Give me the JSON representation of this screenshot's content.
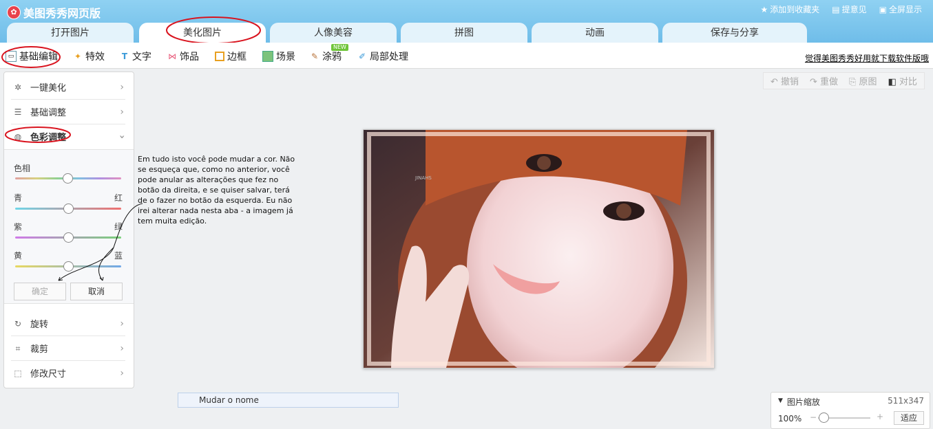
{
  "app": {
    "title": "美图秀秀网页版",
    "logo_icon": "meitu-logo-icon"
  },
  "topbar": {
    "bookmark": "添加到收藏夹",
    "feedback": "提意见",
    "fullscreen": "全屏显示"
  },
  "tabs": [
    {
      "label": "打开图片"
    },
    {
      "label": "美化图片",
      "active": true
    },
    {
      "label": "人像美容"
    },
    {
      "label": "拼图"
    },
    {
      "label": "动画"
    },
    {
      "label": "保存与分享"
    }
  ],
  "toolbar": {
    "items": [
      {
        "label": "基础编辑",
        "icon": "basic-edit-icon"
      },
      {
        "label": "特效",
        "icon": "magic-wand-icon"
      },
      {
        "label": "文字",
        "icon": "text-icon"
      },
      {
        "label": "饰品",
        "icon": "bow-icon"
      },
      {
        "label": "边框",
        "icon": "frame-icon"
      },
      {
        "label": "场景",
        "icon": "scene-icon"
      },
      {
        "label": "涂鸦",
        "icon": "brush-icon"
      },
      {
        "label": "局部处理",
        "icon": "local-edit-icon"
      }
    ],
    "new_badge": "NEW",
    "download_link": "觉得美图秀秀好用就下载软件版哦"
  },
  "sidebar": {
    "items": [
      {
        "label": "一键美化",
        "icon": "one-click-icon"
      },
      {
        "label": "基础调整",
        "icon": "sliders-icon"
      },
      {
        "label": "色彩调整",
        "icon": "palette-icon"
      },
      {
        "label": "旋转",
        "icon": "rotate-icon"
      },
      {
        "label": "裁剪",
        "icon": "crop-icon"
      },
      {
        "label": "修改尺寸",
        "icon": "resize-icon"
      }
    ],
    "color_panel": {
      "hue_label": "色相",
      "sliders": [
        {
          "left": "青",
          "right": "红"
        },
        {
          "left": "紫",
          "right": "绿"
        },
        {
          "left": "黄",
          "right": "蓝"
        }
      ],
      "confirm": "确定",
      "cancel": "取消"
    }
  },
  "annotation": "Em tudo isto você pode mudar a cor. Não se esqueça que, como no anterior, você pode anular as alterações que fez no botão da direita, e se quiser salvar, terá de o fazer no botão da esquerda. Eu não irei alterar nada nesta aba - a imagem já tem muita edição.",
  "actions": {
    "undo": "撤销",
    "redo": "重做",
    "original": "原图",
    "compare": "对比"
  },
  "photo": {
    "watermark": "JINAHS"
  },
  "filename": "Mudar o nome",
  "zoom": {
    "title": "图片缩放",
    "size": "511x347",
    "percent": "100%",
    "minus": "−",
    "plus": "+",
    "fit": "适应",
    "level": 0.1
  },
  "colors": {
    "titlebar": "#6fbde9",
    "accent_red": "#d9131e"
  }
}
